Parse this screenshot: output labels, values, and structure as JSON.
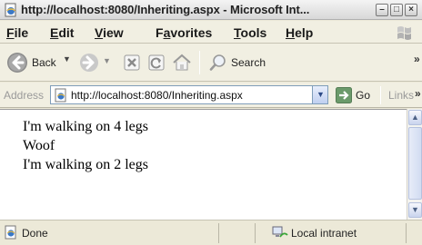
{
  "window": {
    "title": "http://localhost:8080/Inheriting.aspx - Microsoft Int..."
  },
  "menu": {
    "items": [
      {
        "label": "File",
        "mnemonic": "F",
        "rest": "ile"
      },
      {
        "label": "Edit",
        "mnemonic": "E",
        "rest": "dit"
      },
      {
        "label": "View",
        "mnemonic": "V",
        "rest": "iew"
      },
      {
        "label": "Favorites",
        "mnemonic": "a",
        "pre": "F",
        "rest": "vorites"
      },
      {
        "label": "Tools",
        "mnemonic": "T",
        "rest": "ools"
      },
      {
        "label": "Help",
        "mnemonic": "H",
        "rest": "elp"
      }
    ]
  },
  "toolbar": {
    "back_label": "Back",
    "search_label": "Search",
    "overflow": "»"
  },
  "address": {
    "label": "Address",
    "value": "http://localhost:8080/Inheriting.aspx",
    "go_label": "Go",
    "links_label": "Links",
    "overflow": "»"
  },
  "content": {
    "lines": [
      "I'm walking on 4 legs",
      "Woof",
      "I'm walking on 2 legs"
    ]
  },
  "status": {
    "text": "Done",
    "zone": "Local intranet"
  },
  "colors": {
    "chrome": "#ece9d8",
    "toolbar": "#f1efe2",
    "back_green": "#3aa63a",
    "scroll_blue": "#c9d4ee"
  }
}
